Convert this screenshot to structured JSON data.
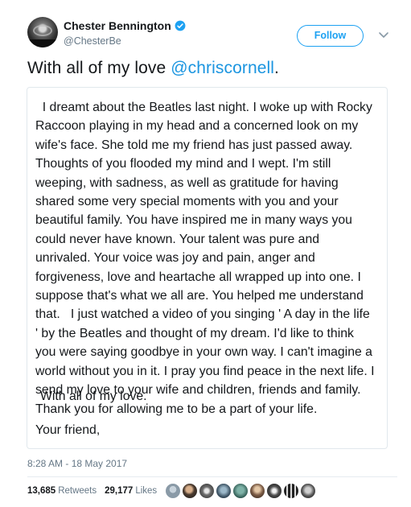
{
  "author": {
    "name": "Chester Bennington",
    "handle": "@ChesterBe",
    "verified_icon": "verified-badge-icon"
  },
  "follow_button": {
    "label": "Follow"
  },
  "caret_icon": "chevron-down-icon",
  "tweet": {
    "text_prefix": "With all of my love ",
    "mention": "@chriscornell",
    "text_suffix": "."
  },
  "letter": {
    "body": "  I dreamt about the Beatles last night. I woke up with Rocky\nRaccoon playing in my head and a concerned look on my\nwife's face. She told me my friend has just passed away.\nThoughts of you flooded my mind and I wept. I'm still\nweeping, with sadness, as well as gratitude for having\nshared some very special moments with you and your\nbeautiful family. You have inspired me in many ways you\ncould never have known. Your talent was pure and\nunrivaled. Your voice was joy and pain, anger and\nforgiveness, love and heartache all wrapped up into one. I\nsuppose that's what we all are. You helped me understand\nthat.   I just watched a video of you singing ' A day in the life\n' by the Beatles and thought of my dream. I'd like to think\nyou were saying goodbye in your own way. I can't imagine a\nworld without you in it. I pray you find peace in the next life. I\nsend my love to your wife and children, friends and family.\nThank you for allowing me to be a part of your life.",
    "sign_off": "With all of my love.",
    "closing": "Your friend,"
  },
  "timestamp": "8:28 AM - 18 May 2017",
  "stats": {
    "retweets_count": "13,685",
    "retweets_label": "Retweets",
    "likes_count": "29,177",
    "likes_label": "Likes"
  },
  "colors": {
    "accent": "#1da1f2",
    "mention": "#1b95e0",
    "muted": "#657786"
  }
}
